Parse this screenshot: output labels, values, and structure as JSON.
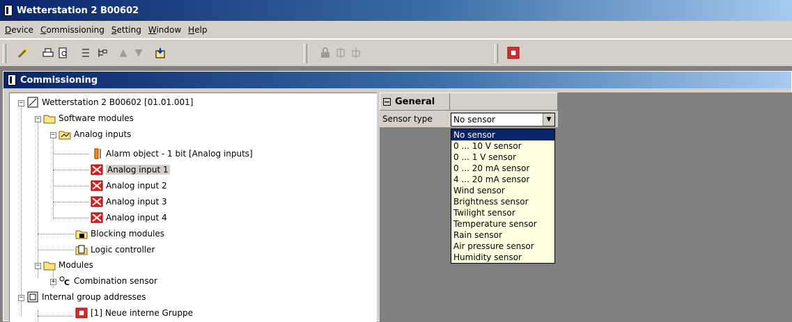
{
  "window": {
    "title": "Wetterstation 2 B00602"
  },
  "menu": [
    {
      "pre": "",
      "ul": "D",
      "post": "evice"
    },
    {
      "pre": "",
      "ul": "C",
      "post": "ommissioning"
    },
    {
      "pre": "",
      "ul": "S",
      "post": "etting"
    },
    {
      "pre": "",
      "ul": "W",
      "post": "indow"
    },
    {
      "pre": "",
      "ul": "H",
      "post": "elp"
    }
  ],
  "toolbar": {
    "icons": [
      "wand-icon",
      "print-icon",
      "preview-icon",
      "list-icon",
      "tree-icon",
      "arrow-up-icon",
      "arrow-down-icon",
      "import-icon",
      "lock-icon",
      "block-icon",
      "unblock-icon",
      "group-icon"
    ]
  },
  "commissioning": {
    "title": "Commissioning",
    "tree": {
      "root": "Wetterstation 2 B00602 [01.01.001]",
      "software_modules": "Software modules",
      "analog_inputs": "Analog inputs",
      "alarm_object": "Alarm object - 1 bit [Analog inputs]",
      "analog_input_1": "Analog input 1",
      "analog_input_2": "Analog input 2",
      "analog_input_3": "Analog input 3",
      "analog_input_4": "Analog input 4",
      "blocking_modules": "Blocking modules",
      "logic_controller": "Logic controller",
      "modules": "Modules",
      "combination_sensor": "Combination sensor",
      "internal_group_addresses": "Internal group addresses",
      "group_1": "[1] Neue interne Gruppe"
    },
    "properties": {
      "section": "General",
      "sensor_type_label": "Sensor type",
      "sensor_type_value": "No sensor",
      "options": [
        "No sensor",
        "0 ... 10 V sensor",
        "0 ... 1 V sensor",
        "0 ... 20 mA sensor",
        "4 ... 20 mA sensor",
        "Wind sensor",
        "Brightness sensor",
        "Twilight sensor",
        "Temperature sensor",
        "Rain sensor",
        "Air pressure sensor",
        "Humidity sensor"
      ]
    }
  }
}
